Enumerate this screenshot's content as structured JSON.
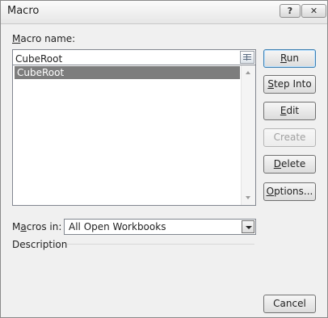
{
  "window": {
    "title": "Macro",
    "help_glyph": "?",
    "close_glyph": "✕"
  },
  "macro_name": {
    "label_mnemonic": "M",
    "label_rest": "acro name:",
    "value": "CubeRoot"
  },
  "macro_list": {
    "items": [
      {
        "label": "CubeRoot",
        "selected": true
      }
    ]
  },
  "buttons": {
    "run": {
      "mnemonic": "R",
      "rest": "un"
    },
    "step_into": {
      "mnemonic": "S",
      "rest": "tep Into"
    },
    "edit": {
      "mnemonic": "E",
      "rest": "dit"
    },
    "create": {
      "label": "Create",
      "enabled": false
    },
    "delete": {
      "mnemonic": "D",
      "rest": "elete"
    },
    "options": {
      "mnemonic": "O",
      "rest": "ptions..."
    },
    "cancel": {
      "label": "Cancel"
    }
  },
  "macros_in": {
    "label_pre": "M",
    "label_mnemonic": "a",
    "label_rest": "cros in:",
    "selected": "All Open Workbooks"
  },
  "description": {
    "label": "Description",
    "text": ""
  }
}
